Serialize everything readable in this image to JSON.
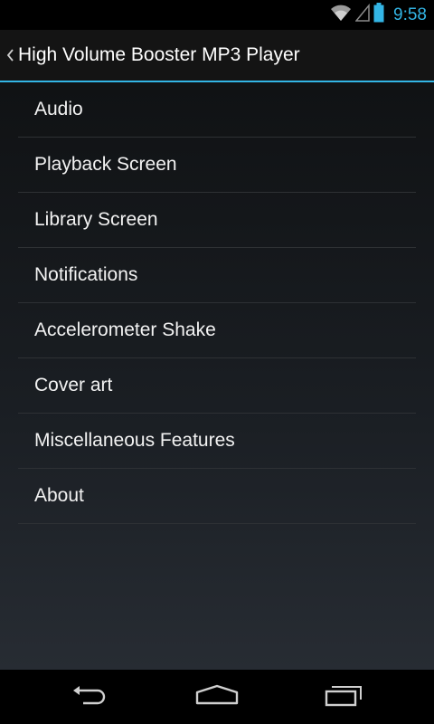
{
  "status_bar": {
    "time": "9:58",
    "icons": [
      "wifi-icon",
      "signal-icon",
      "battery-icon"
    ]
  },
  "action_bar": {
    "up_icon": "chevron-left-icon",
    "title": "High Volume Booster MP3 Player"
  },
  "preferences": {
    "items": [
      {
        "label": "Audio"
      },
      {
        "label": "Playback Screen"
      },
      {
        "label": "Library Screen"
      },
      {
        "label": "Notifications"
      },
      {
        "label": "Accelerometer Shake"
      },
      {
        "label": "Cover art"
      },
      {
        "label": "Miscellaneous Features"
      },
      {
        "label": "About"
      }
    ]
  },
  "nav_bar": {
    "buttons": [
      "back-icon",
      "home-icon",
      "recents-icon"
    ]
  },
  "colors": {
    "accent": "#33b5e5",
    "text": "#f2f2f2",
    "divider": "#2e3134"
  }
}
